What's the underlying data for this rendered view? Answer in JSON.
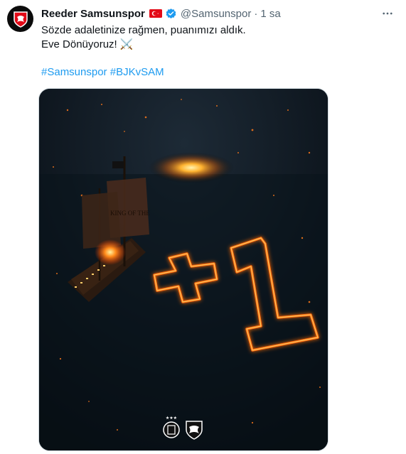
{
  "tweet": {
    "display_name": "Reeder Samsunspor",
    "handle": "@Samsunspor",
    "separator": "·",
    "time": "1 sa",
    "text_line_1": "Sözde adaletinize rağmen, puanımızı aldık.",
    "text_line_2": "Eve Dönüyoruz! ⚔️",
    "hashtag_1": "#Samsunspor",
    "hashtag_2": "#BJKvSAM"
  },
  "icons": {
    "avatar": "samsunspor-logo",
    "flag": "turkey-flag-icon",
    "verified": "verified-badge-icon",
    "more": "more-options-icon"
  },
  "media": {
    "description_icons": [
      "besiktas-crest",
      "samsunspor-crest"
    ],
    "ship_sail_text": "KING OF THE",
    "fire_text": "+1"
  },
  "colors": {
    "link": "#1d9bf0",
    "secondary_text": "#536471",
    "verified": "#1d9bf0",
    "flag_red": "#e30a17"
  }
}
